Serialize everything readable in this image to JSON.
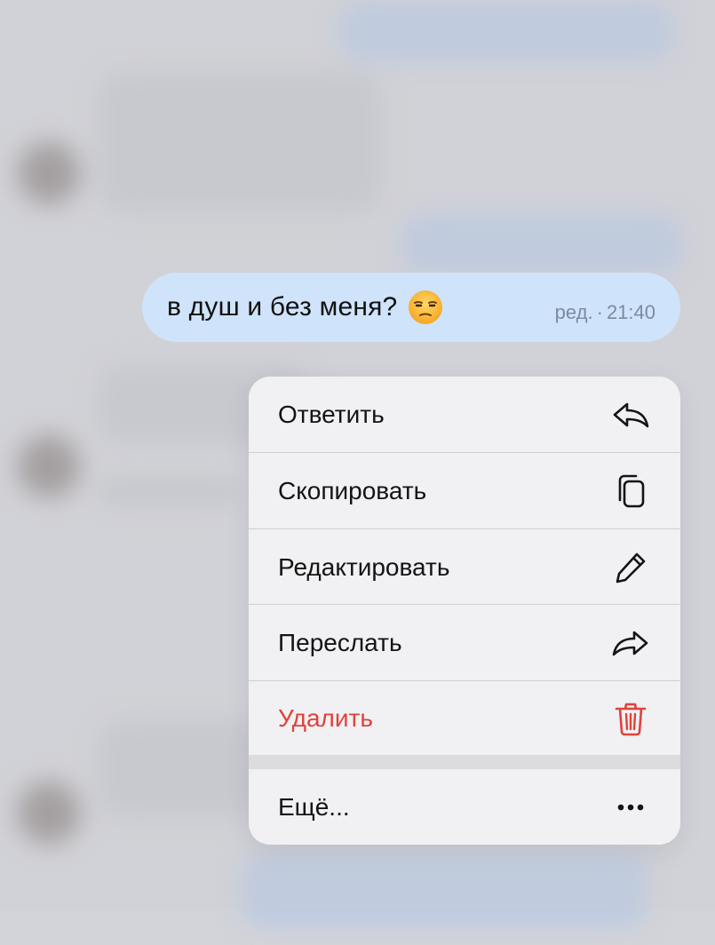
{
  "message": {
    "text": "в душ и без меня?",
    "emoji": "unamused-face-icon",
    "edited_label": "ред.",
    "separator": "·",
    "time": "21:40"
  },
  "context_menu": {
    "items": [
      {
        "label": "Ответить",
        "icon": "reply-icon"
      },
      {
        "label": "Скопировать",
        "icon": "copy-icon"
      },
      {
        "label": "Редактировать",
        "icon": "pencil-icon"
      },
      {
        "label": "Переслать",
        "icon": "forward-icon"
      },
      {
        "label": "Удалить",
        "icon": "trash-icon",
        "color": "#e0423a"
      }
    ],
    "more": {
      "label": "Ещё...",
      "icon": "more-dots-icon"
    }
  },
  "colors": {
    "bubble": "#cfe3fb",
    "menu_background": "#f1f1f3",
    "danger": "#e0423a"
  }
}
